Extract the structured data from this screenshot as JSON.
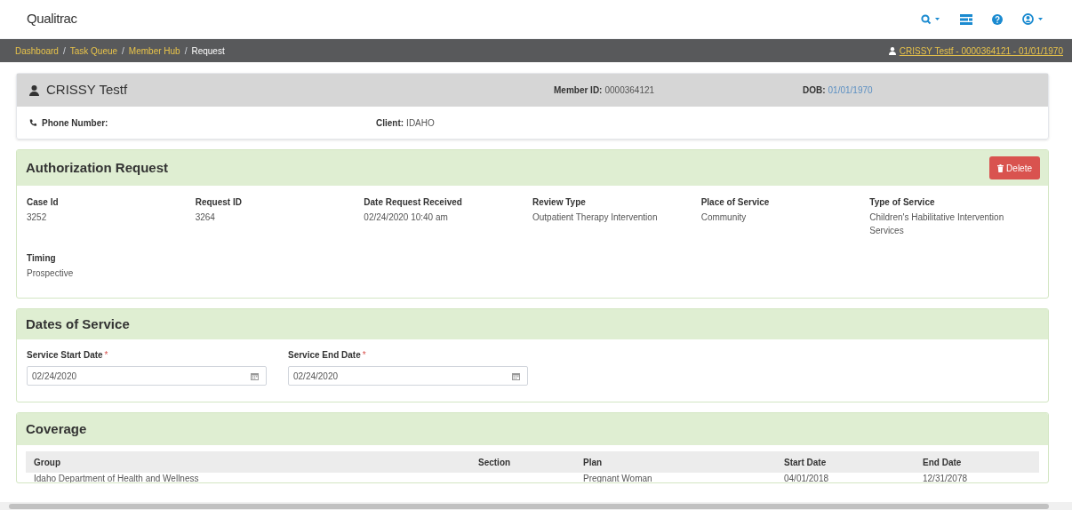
{
  "header": {
    "logo": "Qualitrac"
  },
  "breadcrumbs": [
    {
      "label": "Dashboard",
      "kind": "link"
    },
    {
      "label": "Task Queue",
      "kind": "link"
    },
    {
      "label": "Member Hub",
      "kind": "link"
    },
    {
      "label": "Request",
      "kind": "current"
    }
  ],
  "breadcrumb_separator": "/",
  "member_link": "CRISSY Testf - 0000364121 - 01/01/1970",
  "member": {
    "name": "CRISSY Testf",
    "member_id_label": "Member ID:",
    "member_id": "0000364121",
    "dob_label": "DOB:",
    "dob": "01/01/1970",
    "phone_label": "Phone Number:",
    "client_label": "Client:",
    "client": "IDAHO"
  },
  "authorization": {
    "title": "Authorization Request",
    "delete_button": "Delete",
    "fields": [
      {
        "label": "Case Id",
        "value": "3252"
      },
      {
        "label": "Request ID",
        "value": "3264"
      },
      {
        "label": "Date Request Received",
        "value": "02/24/2020 10:40 am"
      },
      {
        "label": "Review Type",
        "value": "Outpatient Therapy Intervention"
      },
      {
        "label": "Place of Service",
        "value": "Community"
      },
      {
        "label": "Type of Service",
        "value": "Children's Habilitative Intervention Services"
      },
      {
        "label": "Timing",
        "value": "Prospective"
      }
    ]
  },
  "dates_of_service": {
    "title": "Dates of Service",
    "fields": [
      {
        "label": "Service Start Date",
        "required_mark": "*",
        "value": "02/24/2020"
      },
      {
        "label": "Service End Date",
        "required_mark": "*",
        "value": "02/24/2020"
      }
    ]
  },
  "coverage": {
    "title": "Coverage",
    "columns": [
      "Group",
      "Section",
      "Plan",
      "Start Date",
      "End Date"
    ],
    "rows": [
      [
        "Idaho Department of Health and Wellness",
        "",
        "Pregnant Woman",
        "04/01/2018",
        "12/31/2078"
      ]
    ]
  }
}
